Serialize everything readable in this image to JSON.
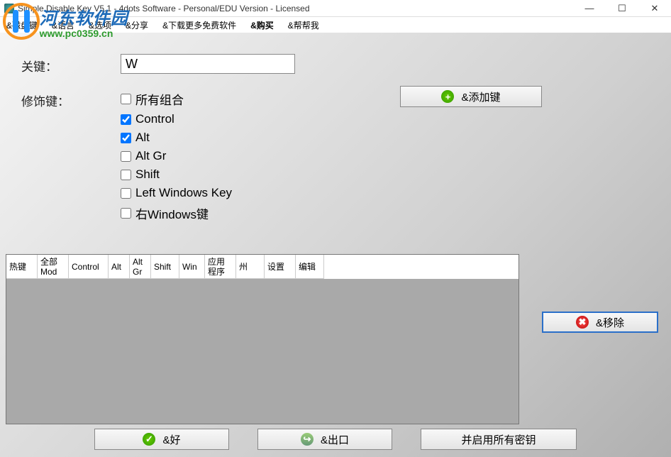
{
  "window": {
    "title": "Simple Disable Key V5.1 - 4dots Software - Personal/EDU Version - Licensed",
    "min": "—",
    "max": "☐",
    "close": "✕"
  },
  "watermark": {
    "cn": "河东软件园",
    "en": "www.pc0359.cn"
  },
  "menu": {
    "item1": "&磁盘键",
    "item2": "&语言",
    "item3": "&选项",
    "item4": "&分享",
    "item5": "&下载更多免费软件",
    "item6": "&购买",
    "item7": "&帮帮我"
  },
  "labels": {
    "key": "关键：",
    "modifier": "修饰键："
  },
  "key_value": "W",
  "modifiers": {
    "all": {
      "label": "所有组合",
      "checked": false
    },
    "control": {
      "label": "Control",
      "checked": true
    },
    "alt": {
      "label": "Alt",
      "checked": true
    },
    "altgr": {
      "label": "Alt Gr",
      "checked": false
    },
    "shift": {
      "label": "Shift",
      "checked": false
    },
    "lwin": {
      "label": "Left Windows Key",
      "checked": false
    },
    "rwin": {
      "label": "右Windows键",
      "checked": false
    }
  },
  "buttons": {
    "add": "&添加键",
    "remove": "&移除",
    "ok": "&好",
    "exit": "&出口",
    "enable_all": "并启用所有密钥"
  },
  "grid": {
    "cols": {
      "hotkey": "热键",
      "allmod": "全部Mod",
      "control": "Control",
      "alt": "Alt",
      "altgr": "Alt Gr",
      "shift": "Shift",
      "win": "Win",
      "app": "应用程序",
      "state": "州",
      "settings": "设置",
      "edit": "编辑"
    }
  }
}
